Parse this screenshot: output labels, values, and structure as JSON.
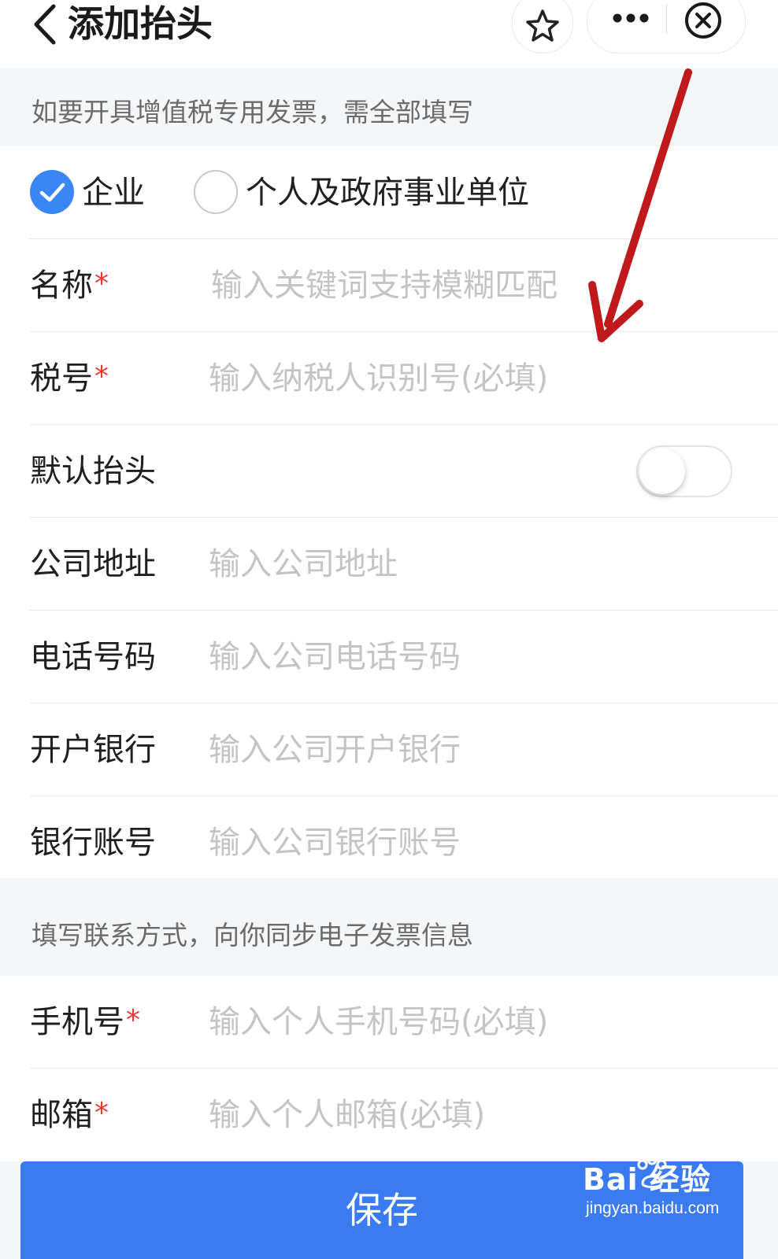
{
  "nav": {
    "title": "添加抬头",
    "icons": [
      "chevron-left-icon",
      "star-icon",
      "more-dots-icon",
      "close-circle-icon"
    ]
  },
  "section1": {
    "hint": "如要开具增值税专用发票，需全部填写"
  },
  "type_options": [
    {
      "label": "企业",
      "checked": true
    },
    {
      "label": "个人及政府事业单位",
      "checked": false
    }
  ],
  "fields": [
    {
      "label": "名称",
      "required": "*",
      "placeholder": "输入关键词支持模糊匹配"
    },
    {
      "label": "税号",
      "required": "*",
      "placeholder": "输入纳税人识别号(必填)"
    },
    {
      "label": "默认抬头",
      "toggle": false
    },
    {
      "label": "公司地址",
      "placeholder": "输入公司地址"
    },
    {
      "label": "电话号码",
      "placeholder": "输入公司电话号码"
    },
    {
      "label": "开户银行",
      "placeholder": "输入公司开户银行"
    },
    {
      "label": "银行账号",
      "placeholder": "输入公司银行账号"
    }
  ],
  "section2": {
    "hint": "填写联系方式，向你同步电子发票信息"
  },
  "contact_fields": [
    {
      "label": "手机号",
      "required": "*",
      "placeholder": "输入个人手机号码(必填)"
    },
    {
      "label": "邮箱",
      "required": "*",
      "placeholder": "输入个人邮箱(必填)"
    }
  ],
  "save_label": "保存",
  "watermark": {
    "logo": "Bai 经验",
    "url": "jingyan.baidu.com"
  },
  "colors": {
    "accent": "#3b7bf2",
    "required": "#e53935",
    "annotation_arrow": "#c0191b"
  }
}
